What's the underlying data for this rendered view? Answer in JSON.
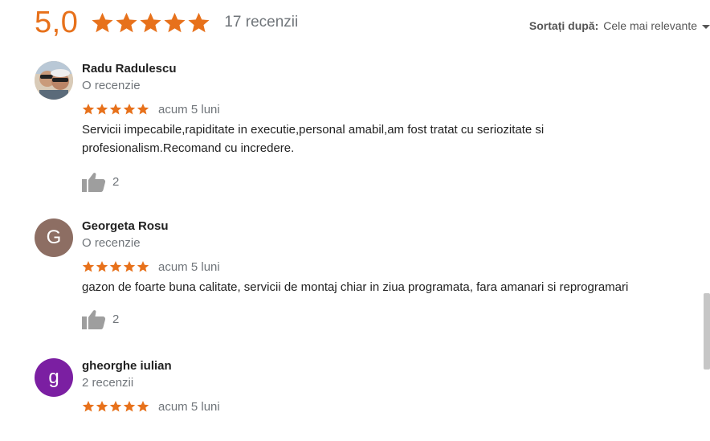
{
  "summary": {
    "rating": "5,0",
    "stars": 5,
    "count_label": "17 recenzii"
  },
  "sort": {
    "label": "Sortați după:",
    "value": "Cele mai relevante",
    "caret_icon": "caret-down-icon"
  },
  "colors": {
    "star": "#e7711b",
    "muted": "#70757a",
    "thumb": "#9e9e9e"
  },
  "reviews": [
    {
      "name": "Radu Radulescu",
      "subtitle": "O recenzie",
      "stars": 5,
      "time": "acum 5 luni",
      "text_lines": [
        "Servicii impecabile,rapiditate in executie,personal amabil,am fost tratat cu seriozitate si",
        "profesionalism.Recomand cu incredere."
      ],
      "likes": "2",
      "avatar": {
        "type": "photo",
        "icon": "user-photo-avatar"
      }
    },
    {
      "name": "Georgeta Rosu",
      "subtitle": "O recenzie",
      "stars": 5,
      "time": "acum 5 luni",
      "text_lines": [
        "gazon de foarte buna calitate, servicii de montaj chiar in ziua programata, fara amanari si reprogramari"
      ],
      "likes": "2",
      "avatar": {
        "type": "letter",
        "letter": "G",
        "color": "#8d6e63"
      }
    },
    {
      "name": "gheorghe iulian",
      "subtitle": "2 recenzii",
      "stars": 5,
      "time": "acum 5 luni",
      "avatar": {
        "type": "letter",
        "letter": "g",
        "color": "#7b1fa2"
      }
    }
  ]
}
